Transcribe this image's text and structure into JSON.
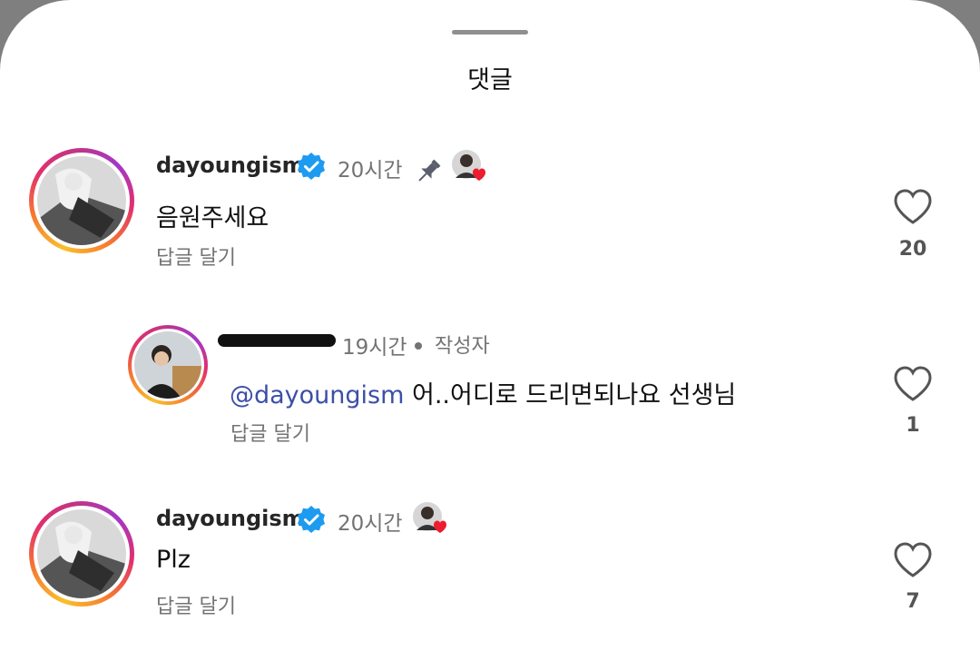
{
  "sheet": {
    "title": "댓글"
  },
  "comments": [
    {
      "username": "dayoungism",
      "time": "20시간",
      "text": "음원주세요",
      "reply_label": "답글 달기",
      "likes": "20",
      "verified": true,
      "pinned": true,
      "liked_by_author": true
    },
    {
      "username": "",
      "time": "19시간",
      "author_label": "작성자",
      "mention": "@dayoungism",
      "text": " 어..어디로 드리면되나요 선생님",
      "reply_label": "답글 달기",
      "likes": "1"
    },
    {
      "username": "dayoungism",
      "time": "20시간",
      "text": "Plz",
      "reply_label": "답글 달기",
      "likes": "7",
      "verified": true,
      "liked_by_author": true
    }
  ],
  "colors": {
    "accent_verified": "#1d9bf0",
    "mention": "#3c4fa8",
    "heart_red": "#ed1c2e"
  },
  "icons": [
    "verified-badge-icon",
    "pin-icon",
    "heart-icon",
    "author-liked-heart-icon"
  ]
}
